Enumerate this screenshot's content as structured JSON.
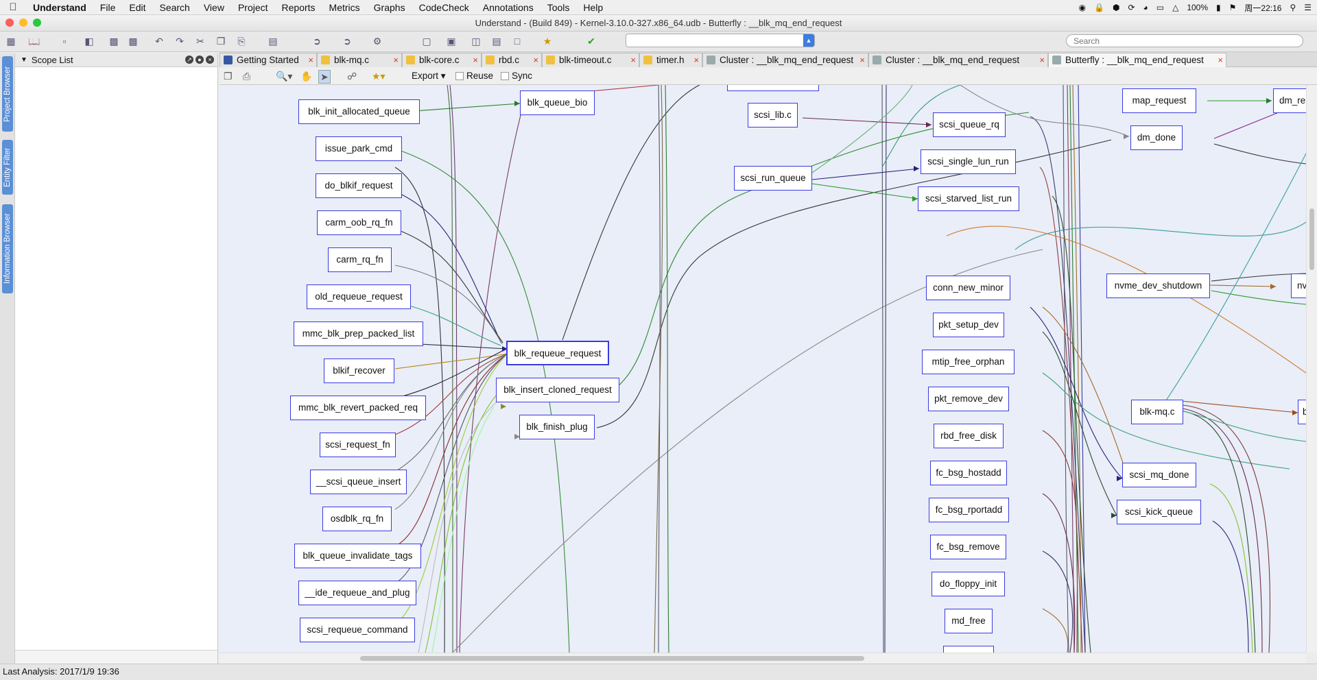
{
  "menubar": {
    "apple": "",
    "items": [
      "Understand",
      "File",
      "Edit",
      "Search",
      "View",
      "Project",
      "Reports",
      "Metrics",
      "Graphs",
      "CodeCheck",
      "Annotations",
      "Tools",
      "Help"
    ],
    "battery": "100%",
    "clock": "周一22:16"
  },
  "window": {
    "title": "Understand - (Build 849) - Kernel-3.10.0-327.x86_64.udb - Butterfly : __blk_mq_end_request"
  },
  "toolbar": {
    "search_placeholder": "Search"
  },
  "side_tabs": [
    "Project Browser",
    "Entity Filter",
    "Information Browser"
  ],
  "scope_panel": {
    "title": "Scope List"
  },
  "tabs": [
    {
      "label": "Getting Started",
      "icon": "book-icon",
      "active": false
    },
    {
      "label": "blk-mq.c",
      "icon": "file-c-icon",
      "active": false
    },
    {
      "label": "blk-core.c",
      "icon": "file-c-icon",
      "active": false
    },
    {
      "label": "rbd.c",
      "icon": "file-c-icon",
      "active": false
    },
    {
      "label": "blk-timeout.c",
      "icon": "file-c-icon",
      "active": false
    },
    {
      "label": "timer.h",
      "icon": "file-h-icon",
      "active": false
    },
    {
      "label": "Cluster  : __blk_mq_end_request",
      "icon": "cluster-graph-icon",
      "active": false
    },
    {
      "label": "Cluster  : __blk_mq_end_request",
      "icon": "cluster-graph-icon",
      "active": false
    },
    {
      "label": "Butterfly : __blk_mq_end_request",
      "icon": "butterfly-graph-icon",
      "active": true
    }
  ],
  "graph_toolbar": {
    "export_label": "Export",
    "reuse_label": "Reuse",
    "sync_label": "Sync"
  },
  "graph_nodes": {
    "blk_init_allocated_queue": "blk_init_allocated_queue",
    "issue_park_cmd": "issue_park_cmd",
    "do_blkif_request": "do_blkif_request",
    "carm_oob_rq_fn": "carm_oob_rq_fn",
    "carm_rq_fn": "carm_rq_fn",
    "old_requeue_request": "old_requeue_request",
    "mmc_blk_prep_packed_list": "mmc_blk_prep_packed_list",
    "blkif_recover": "blkif_recover",
    "mmc_blk_revert_packed_req": "mmc_blk_revert_packed_req",
    "scsi_request_fn": "scsi_request_fn",
    "__scsi_queue_insert": "__scsi_queue_insert",
    "osdblk_rq_fn": "osdblk_rq_fn",
    "blk_queue_invalidate_tags": "blk_queue_invalidate_tags",
    "__ide_requeue_and_plug": "__ide_requeue_and_plug",
    "scsi_requeue_command": "scsi_requeue_command",
    "blk_queue_bio": "blk_queue_bio",
    "blk_requeue_request": "blk_requeue_request",
    "blk_insert_cloned_request": "blk_insert_cloned_request",
    "blk_finish_plug": "blk_finish_plug",
    "scsi_lib_c": "scsi_lib.c",
    "scsi_run_queue": "scsi_run_queue",
    "scsi_queue_rq": "scsi_queue_rq",
    "scsi_single_lun_run": "scsi_single_lun_run",
    "scsi_starved_list_run": "scsi_starved_list_run",
    "conn_new_minor": "conn_new_minor",
    "pkt_setup_dev": "pkt_setup_dev",
    "mtip_free_orphan": "mtip_free_orphan",
    "pkt_remove_dev": "pkt_remove_dev",
    "rbd_free_disk": "rbd_free_disk",
    "fc_bsg_hostadd": "fc_bsg_hostadd",
    "fc_bsg_rportadd": "fc_bsg_rportadd",
    "fc_bsg_remove": "fc_bsg_remove",
    "do_floppy_init": "do_floppy_init",
    "md_free": "md_free",
    "map_request": "map_request",
    "dm_done": "dm_done",
    "dm_re_partial": "dm_re",
    "nvme_dev_shutdown": "nvme_dev_shutdown",
    "nv_partial": "nv",
    "blk_mq_c": "blk-mq.c",
    "b_partial": "b",
    "scsi_mq_done": "scsi_mq_done",
    "scsi_kick_queue": "scsi_kick_queue"
  },
  "statusbar": {
    "text": "Last Analysis: 2017/1/9 19:36"
  },
  "colors": {
    "node_border": "#3a3ae0",
    "graph_bg": "#e9eef8",
    "side_tab": "#5b8fd6",
    "tab_close": "#d32"
  }
}
